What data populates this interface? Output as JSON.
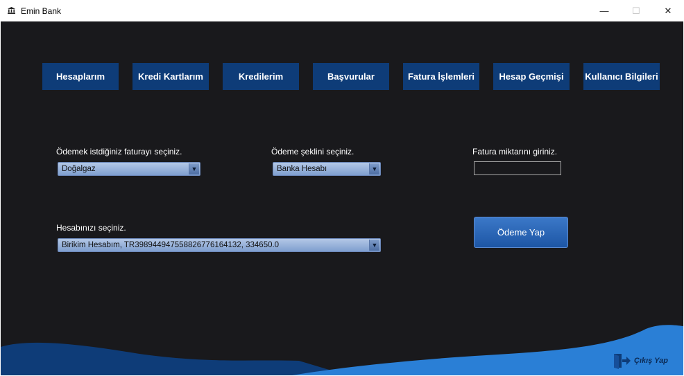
{
  "window": {
    "title": "Emin Bank",
    "controls": {
      "minimize": "—",
      "maximize": "☐",
      "close": "✕"
    }
  },
  "nav": {
    "items": [
      {
        "label": "Hesaplarım"
      },
      {
        "label": "Kredi Kartlarım"
      },
      {
        "label": "Kredilerim"
      },
      {
        "label": "Başvurular"
      },
      {
        "label": "Fatura İşlemleri"
      },
      {
        "label": "Hesap Geçmişi"
      },
      {
        "label": "Kullanıcı Bilgileri"
      }
    ]
  },
  "form": {
    "bill_label": "Ödemek istdiğiniz faturayı seçiniz.",
    "bill_value": "Doğalgaz",
    "method_label": "Ödeme şeklini seçiniz.",
    "method_value": "Banka Hesabı",
    "amount_label": "Fatura miktarını giriniz.",
    "amount_value": "",
    "account_label": "Hesabınızı seçiniz.",
    "account_value": "Birikim Hesabım, TR398944947558826776164132, 334650.0",
    "pay_label": "Ödeme Yap",
    "dropdown_arrow": "▼"
  },
  "footer": {
    "logout_label": "Çıkış Yap"
  },
  "colors": {
    "background": "#19191c",
    "nav_button": "#0e3c78",
    "wave_dark": "#0e3c78",
    "wave_light": "#2a7fd6"
  },
  "icons": {
    "app": "bank-icon",
    "logout": "logout-door-icon"
  }
}
